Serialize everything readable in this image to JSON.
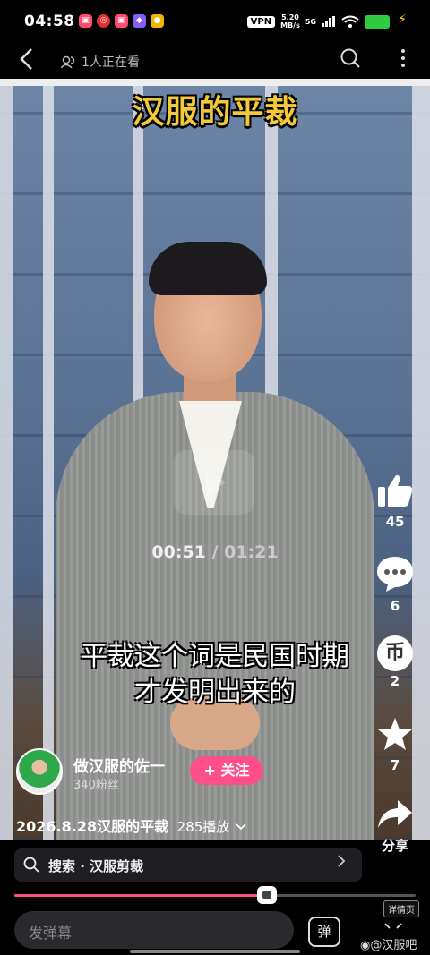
{
  "status_bar": {
    "time": "04:58",
    "vpn": "VPN",
    "speed_value": "5.20",
    "speed_unit": "MB/s",
    "network": "5G",
    "notification_icons": [
      "red-app-icon",
      "netease-icon",
      "red-app-icon",
      "purple-app-icon",
      "yellow-app-icon"
    ],
    "colors": {
      "battery": "#2ecc40",
      "bolt": "#ffd400"
    }
  },
  "top_nav": {
    "viewers": "1人正在看"
  },
  "video": {
    "title": "汉服的平裁",
    "current_time": "00:51",
    "separator": "/",
    "duration": "01:21",
    "subtitle_line1": "平裁这个词是民国时期",
    "subtitle_line2": "才发明出来的",
    "progress_fraction": 0.63
  },
  "rail": {
    "likes": "45",
    "comments": "6",
    "coins": "2",
    "coin_glyph": "币",
    "favorites": "7",
    "share_label": "分享"
  },
  "author": {
    "name": "做汉服的佐一",
    "fans": "340粉丝",
    "follow_label": "+ 关注"
  },
  "description": {
    "text": "2026.8.28汉服的平裁",
    "plays": "285播放"
  },
  "search": {
    "text": "搜索 · 汉服剪裁"
  },
  "bottom": {
    "danmu_placeholder": "发弹幕",
    "danmu_button": "弹",
    "details_label": "详情页",
    "watermark": "@汉服吧"
  },
  "colors": {
    "accent": "#ff4f8b",
    "title": "#f3c93a"
  }
}
